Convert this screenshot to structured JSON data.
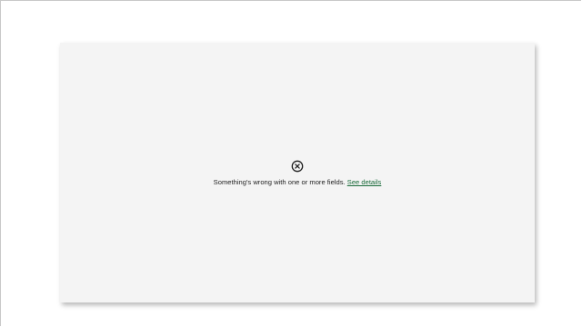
{
  "error": {
    "icon": "close-circle-icon",
    "message": "Something's wrong with one or more fields.",
    "link_label": "See details",
    "link_color": "#1a6b3a"
  }
}
